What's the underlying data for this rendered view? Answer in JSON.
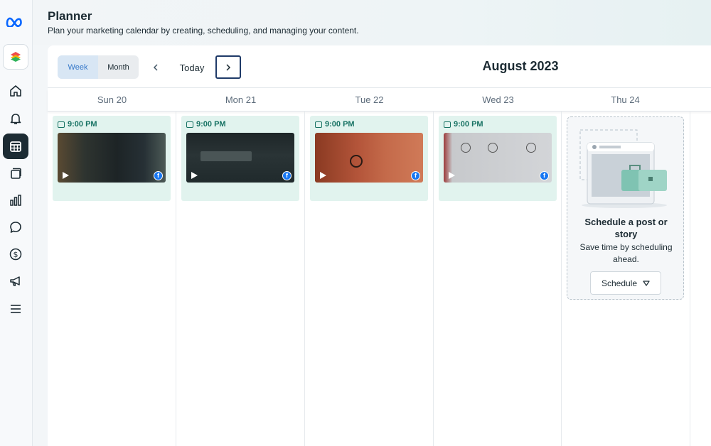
{
  "header": {
    "title": "Planner",
    "subtitle": "Plan your marketing calendar by creating, scheduling, and managing your content."
  },
  "sidebar": {
    "items": [
      {
        "icon": "meta-logo-icon"
      },
      {
        "icon": "layers-icon"
      },
      {
        "icon": "home-icon"
      },
      {
        "icon": "bell-icon"
      },
      {
        "icon": "planner-icon",
        "active": true
      },
      {
        "icon": "posts-icon"
      },
      {
        "icon": "insights-icon"
      },
      {
        "icon": "inbox-icon"
      },
      {
        "icon": "monetization-icon"
      },
      {
        "icon": "ads-icon"
      },
      {
        "icon": "menu-icon"
      }
    ]
  },
  "toolbar": {
    "week_label": "Week",
    "month_label": "Month",
    "today_label": "Today",
    "month_title": "August 2023"
  },
  "days": [
    {
      "label": "Sun 20"
    },
    {
      "label": "Mon 21"
    },
    {
      "label": "Tue 22"
    },
    {
      "label": "Wed 23"
    },
    {
      "label": "Thu 24"
    }
  ],
  "posts": [
    {
      "time": "9:00 PM",
      "platform": "facebook",
      "media": "video"
    },
    {
      "time": "9:00 PM",
      "platform": "facebook",
      "media": "video"
    },
    {
      "time": "9:00 PM",
      "platform": "facebook",
      "media": "video"
    },
    {
      "time": "9:00 PM",
      "platform": "facebook",
      "media": "video"
    }
  ],
  "schedule_card": {
    "title": "Schedule a post or story",
    "body": "Save time by scheduling ahead.",
    "button_label": "Schedule"
  },
  "colors": {
    "accent": "#3578c9",
    "post_bg": "#e1f3ee",
    "post_time": "#177263",
    "facebook": "#1877f2"
  }
}
